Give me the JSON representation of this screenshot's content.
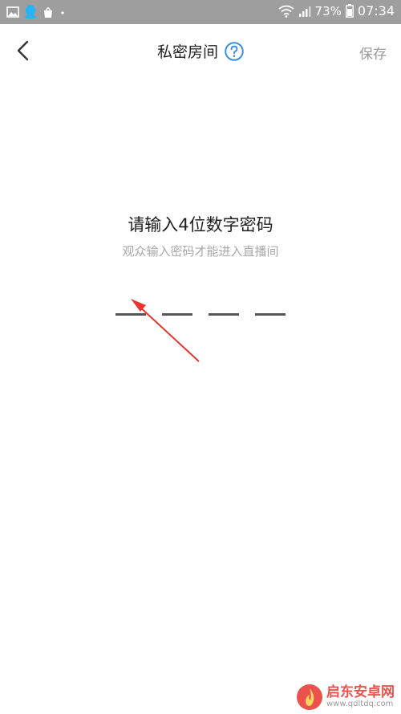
{
  "status_bar": {
    "battery": "73%",
    "time": "07:34",
    "icons": [
      "gallery-icon",
      "qq-icon",
      "bag-icon",
      "dot-icon",
      "wifi-icon",
      "signal-icon",
      "battery-icon"
    ]
  },
  "header": {
    "title": "私密房间",
    "save_label": "保存",
    "icons": [
      "back-chevron-icon",
      "help-question-icon"
    ]
  },
  "main": {
    "prompt_title": "请输入4位数字密码",
    "prompt_subtitle": "观众输入密码才能进入直播间",
    "pin_length": 4,
    "pin_value": ""
  },
  "annotation": {
    "arrow_color": "#e8352e"
  },
  "watermark": {
    "name": "启东安卓网",
    "url": "www.qdltdq.com"
  },
  "colors": {
    "status_bar_bg": "#9e9e9e",
    "accent_help": "#3d8ee6",
    "save_text": "#999999",
    "subtitle_text": "#a8a8a8",
    "pin_line": "#555555",
    "brand_red": "#e8352e"
  }
}
